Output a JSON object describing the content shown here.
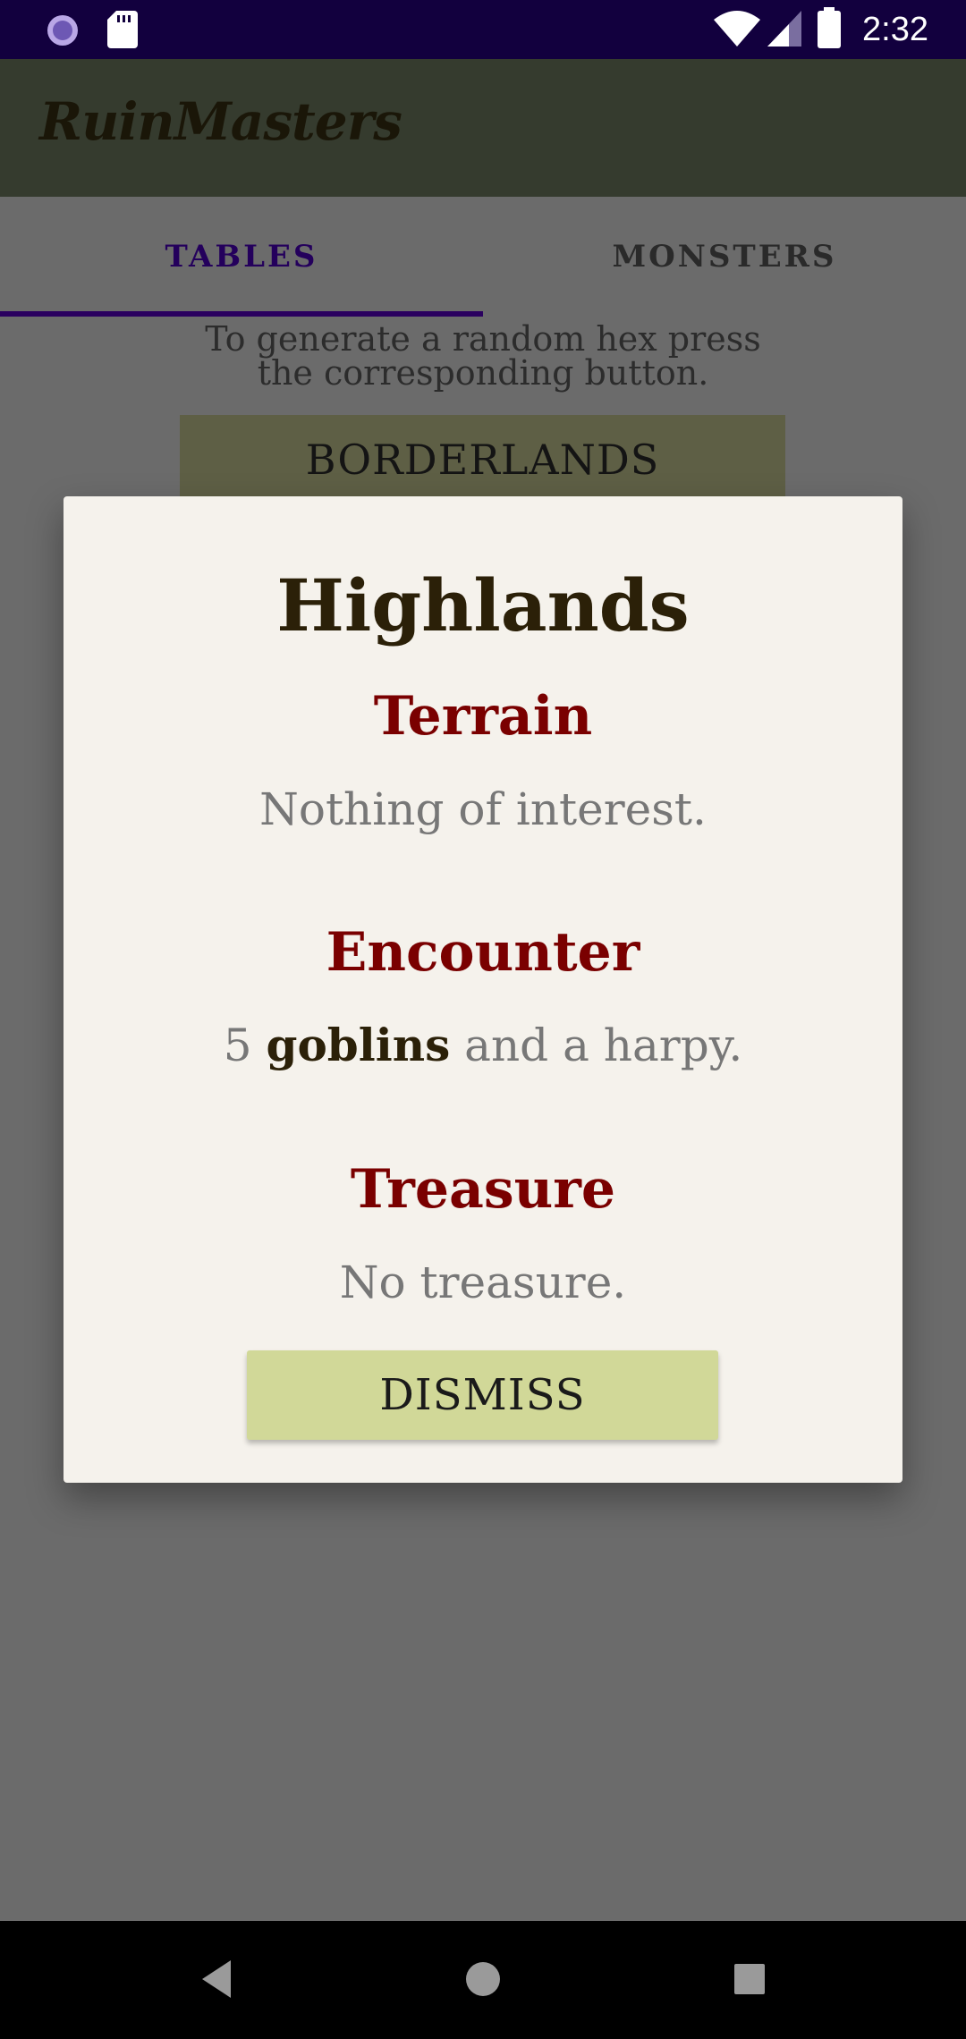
{
  "status_bar": {
    "time": "2:32",
    "icons": [
      "settings-sync-icon",
      "sd-card-icon",
      "wifi-icon",
      "signal-icon",
      "battery-icon"
    ],
    "background_color": "#12003e"
  },
  "app_bar": {
    "title": "RuinMasters",
    "background_color": "#353b2e"
  },
  "tabs": [
    {
      "label": "TABLES",
      "selected": true
    },
    {
      "label": "MONSTERS",
      "selected": false
    }
  ],
  "instructions": {
    "line1": "To generate a random hex press",
    "line2": "the corresponding button."
  },
  "region_button_label": "BORDERLANDS",
  "dialog": {
    "title": "Highlands",
    "terrain": {
      "heading": "Terrain",
      "text": "Nothing of interest."
    },
    "encounter": {
      "heading": "Encounter",
      "count": "5",
      "monster": "goblins",
      "rest": "and a harpy."
    },
    "treasure": {
      "heading": "Treasure",
      "text": "No treasure."
    },
    "dismiss_label": "DISMISS"
  },
  "nav_bar": {
    "icons": [
      "back-icon",
      "home-icon",
      "recents-icon"
    ]
  },
  "colors": {
    "accent": "#7a0000",
    "button": "#d1d898",
    "tab_indicator": "#2a005f"
  }
}
